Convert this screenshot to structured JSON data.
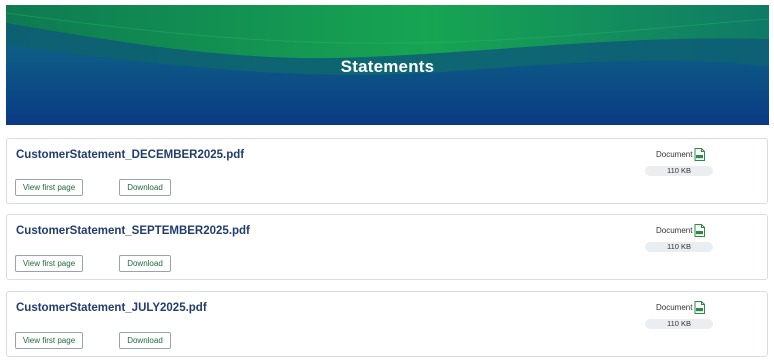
{
  "header": {
    "title": "Statements"
  },
  "colors": {
    "hero_green": "#14a055",
    "hero_blue": "#0b3f82",
    "link_blue": "#213d6e",
    "button_text_green": "#1f6b3c",
    "icon_green": "#2e8b45"
  },
  "statements": [
    {
      "file_name": "CustomerStatement_DECEMBER2025.pdf",
      "view_label": "View first page",
      "download_label": "Download",
      "doc_type": "Document",
      "doc_icon": "pdf-file-icon",
      "size": "110 KB"
    },
    {
      "file_name": "CustomerStatement_SEPTEMBER2025.pdf",
      "view_label": "View first page",
      "download_label": "Download",
      "doc_type": "Document",
      "doc_icon": "pdf-file-icon",
      "size": "110 KB"
    },
    {
      "file_name": "CustomerStatement_JULY2025.pdf",
      "view_label": "View first page",
      "download_label": "Download",
      "doc_type": "Document",
      "doc_icon": "pdf-file-icon",
      "size": "110 KB"
    }
  ]
}
